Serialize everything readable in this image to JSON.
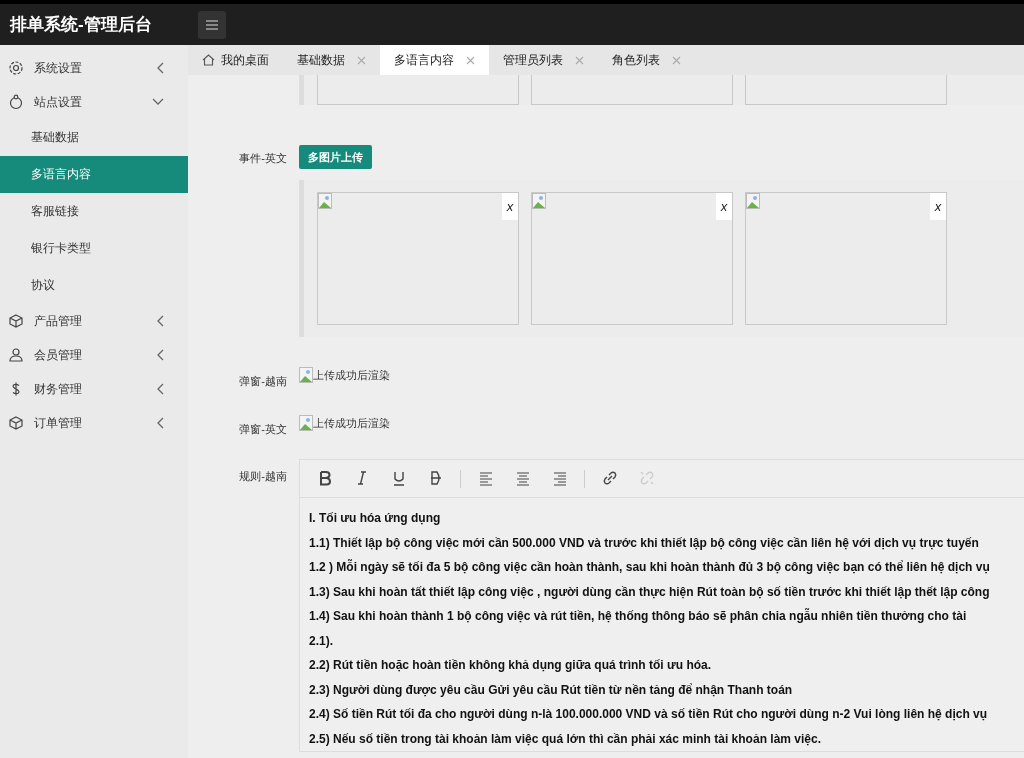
{
  "header": {
    "title": "排单系统-管理后台"
  },
  "sidebar": {
    "items": [
      {
        "label": "系统设置",
        "kind": "gear",
        "expanded": false
      },
      {
        "label": "站点设置",
        "kind": "site",
        "expanded": true,
        "children": [
          {
            "label": "基础数据",
            "selected": false
          },
          {
            "label": "多语言内容",
            "selected": true
          },
          {
            "label": "客服链接",
            "selected": false
          },
          {
            "label": "银行卡类型",
            "selected": false
          },
          {
            "label": "协议",
            "selected": false
          }
        ]
      },
      {
        "label": "产品管理",
        "kind": "cube",
        "expanded": false
      },
      {
        "label": "会员管理",
        "kind": "user",
        "expanded": false
      },
      {
        "label": "财务管理",
        "kind": "dollar",
        "expanded": false
      },
      {
        "label": "订单管理",
        "kind": "cube",
        "expanded": false
      }
    ]
  },
  "tabs": [
    {
      "label": "我的桌面",
      "kind": "home",
      "selected": false
    },
    {
      "label": "基础数据",
      "kind": "closable",
      "selected": false
    },
    {
      "label": "多语言内容",
      "kind": "closable",
      "selected": true
    },
    {
      "label": "管理员列表",
      "kind": "closable",
      "selected": false
    },
    {
      "label": "角色列表",
      "kind": "closable",
      "selected": false
    }
  ],
  "form": {
    "rows": [
      {
        "kind": "gallery_tail"
      },
      {
        "kind": "upload",
        "label": "事件-英文",
        "button": "多图片上传",
        "images": [
          {
            "close": "x"
          },
          {
            "close": "x"
          },
          {
            "close": "x"
          }
        ]
      },
      {
        "kind": "image",
        "label": "弹窗-越南",
        "alt": "上传成功后渲染"
      },
      {
        "kind": "image",
        "label": "弹窗-英文",
        "alt": "上传成功后渲染"
      },
      {
        "kind": "editor",
        "label": "规则-越南",
        "lines": [
          "I. Tối ưu hóa ứng dụng",
          "1.1) Thiết lập bộ công việc mới cần 500.000 VND và trước khi thiết lập bộ công việc cần liên hệ với dịch vụ trực tuyến",
          "1.2 ) Mỗi ngày sẽ tối đa 5 bộ công việc cần hoàn thành, sau khi hoàn thành đủ 3 bộ công việc bạn có thể  liên hệ dịch vụ",
          "1.3) Sau khi hoàn tất thiết lập công việc , người dùng cần thực hiện Rút toàn bộ số tiền trước khi thiết lập thết lập công",
          "1.4)  Sau khi hoàn thành 1 bộ công việc và rút tiền, hệ thống thông báo sẽ phân chia ngẫu nhiên tiền thưởng  cho tài",
          "2.1).",
          "2.2) Rút tiền hoặc hoàn tiền không khả dụng giữa quá trình tối ưu hóa.",
          "2.3) Người dùng được yêu cầu Gửi yêu cầu Rút tiền từ nền tảng để nhận Thanh toán",
          "2.4)  Số tiền Rút tối đa cho người dùng n-là 100.000.000 VND và số tiền Rút cho người dùng n-2 Vui lòng liên hệ dịch vụ",
          "2.5) Nếu số tiền trong tài khoản làm việc quá lớn thì cần phải xác minh tài khoản làm việc."
        ]
      }
    ]
  }
}
